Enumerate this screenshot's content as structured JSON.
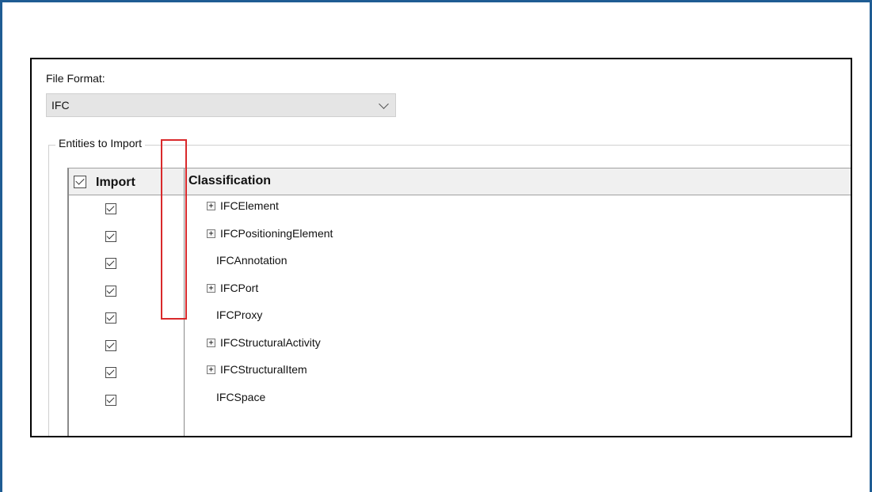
{
  "file_format": {
    "label": "File Format:",
    "selected": "IFC"
  },
  "entities": {
    "group_title": "Entities to Import",
    "headers": {
      "import": "Import",
      "classification": "Classification"
    },
    "rows": [
      {
        "label": "IFCElement",
        "expandable": true,
        "checked": true
      },
      {
        "label": "IFCPositioningElement",
        "expandable": true,
        "checked": true
      },
      {
        "label": "IFCAnnotation",
        "expandable": false,
        "checked": true
      },
      {
        "label": "IFCPort",
        "expandable": true,
        "checked": true
      },
      {
        "label": "IFCProxy",
        "expandable": false,
        "checked": true
      },
      {
        "label": "IFCStructuralActivity",
        "expandable": true,
        "checked": true
      },
      {
        "label": "IFCStructuralItem",
        "expandable": true,
        "checked": true
      },
      {
        "label": "IFCSpace",
        "expandable": false,
        "checked": true
      }
    ]
  },
  "highlight": {
    "color": "#d9292b"
  },
  "expander_glyph": "+"
}
